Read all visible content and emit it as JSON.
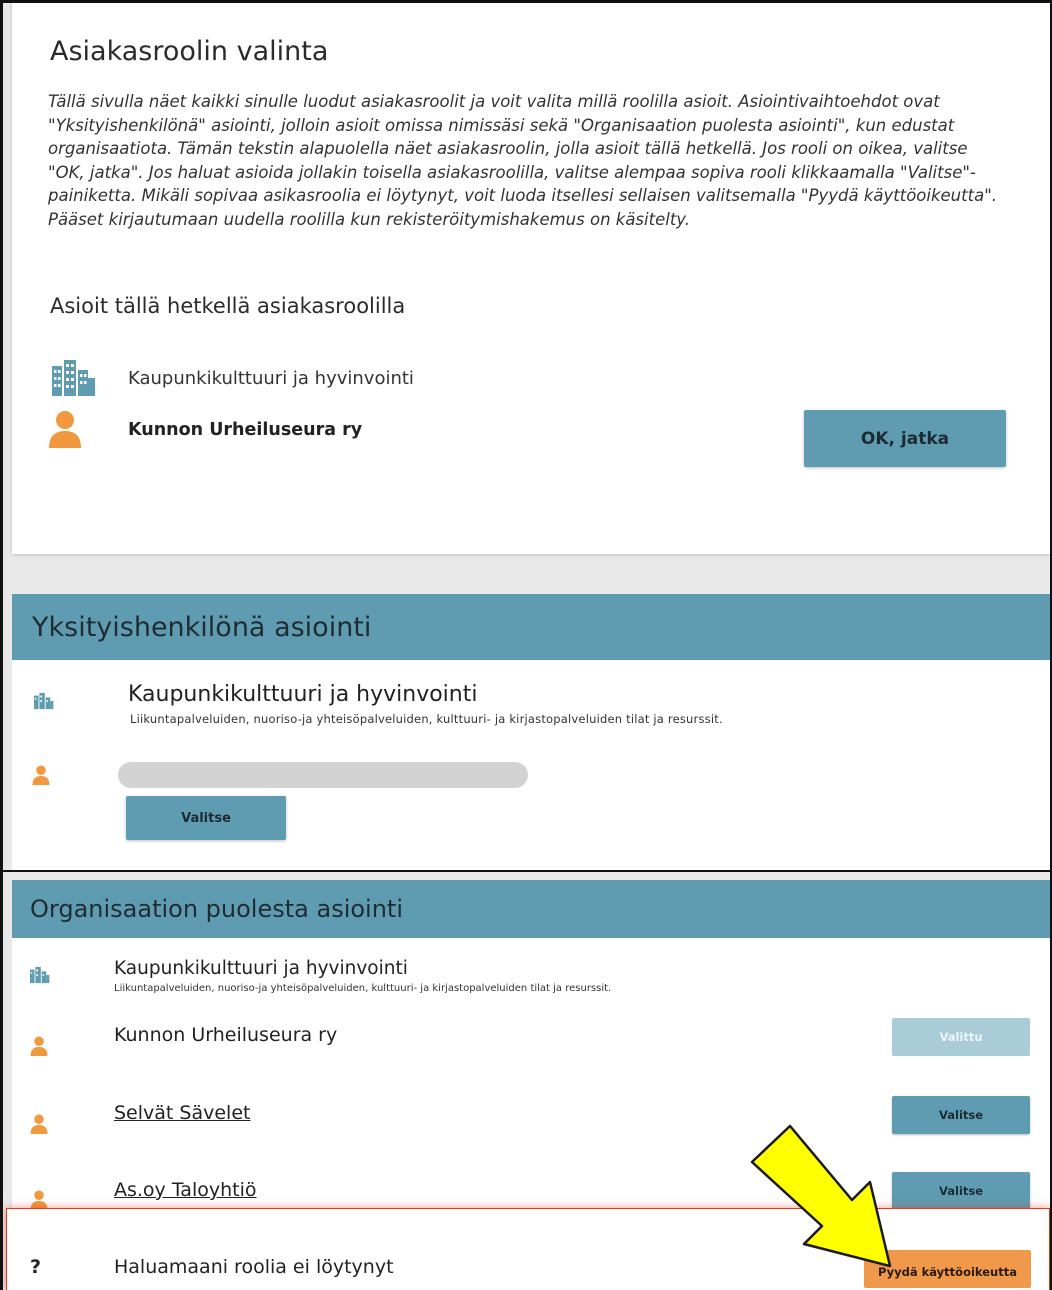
{
  "current": {
    "title": "Asiakasroolin valinta",
    "intro": "Tällä sivulla näet kaikki sinulle luodut asiakasroolit ja voit valita millä roolilla asioit. Asiointivaihtoehdot ovat \"Yksityishenkilönä\" asiointi, jolloin asioit omissa nimissäsi sekä \"Organisaation puolesta asiointi\", kun edustat organisaatiota. Tämän tekstin alapuolella näet asiakasroolin, jolla asioit tällä hetkellä. Jos rooli on oikea, valitse \"OK, jatka\". Jos haluat asioida jollakin toisella asiakasroolilla, valitse alempaa sopiva rooli klikkaamalla \"Valitse\"-painiketta. Mikäli sopivaa asikasroolia ei löytynyt, voit luoda itsellesi sellaisen valitsemalla \"Pyydä käyttöoikeutta\". Pääset kirjautumaan uudella roolilla kun rekisteröitymishakemus on käsitelty.",
    "subtitle": "Asioit tällä hetkellä asiakasroolilla",
    "org_name": "Kaupunkikulttuuri ja hyvinvointi",
    "role_name": "Kunnon Urheiluseura ry",
    "ok_label": "OK, jatka",
    "org_icon": "building-icon",
    "person_icon": "person-icon"
  },
  "private": {
    "header": "Yksityishenkilönä asiointi",
    "org_name": "Kaupunkikulttuuri ja hyvinvointi",
    "org_desc": "Liikuntapalveluiden, nuoriso-ja yhteisöpalveluiden, kulttuuri- ja kirjastopalveluiden tilat ja resurssit.",
    "select_label": "Valitse"
  },
  "organization": {
    "header": "Organisaation puolesta asiointi",
    "org_name": "Kaupunkikulttuuri ja hyvinvointi",
    "org_desc": "Liikuntapalveluiden, nuoriso-ja yhteisöpalveluiden, kulttuuri- ja kirjastopalveluiden tilat ja resurssit.",
    "roles": [
      {
        "name": "Kunnon Urheiluseura ry",
        "button": "Valittu",
        "selected": true
      },
      {
        "name": "Selvät Sävelet",
        "button": "Valitse",
        "selected": false
      },
      {
        "name": "As.oy Taloyhtiö",
        "button": "Valitse",
        "selected": false
      }
    ],
    "missing_mark": "?",
    "missing_label": "Haluamaani roolia ei löytynyt",
    "request_label": "Pyydä käyttöoikeutta"
  },
  "colors": {
    "accent": "#5f9cb1",
    "accent_disabled": "#a9ccd8",
    "person": "#f0993e",
    "request": "#f1994a",
    "highlight": "#e8391e",
    "arrow": "#ffff00"
  }
}
